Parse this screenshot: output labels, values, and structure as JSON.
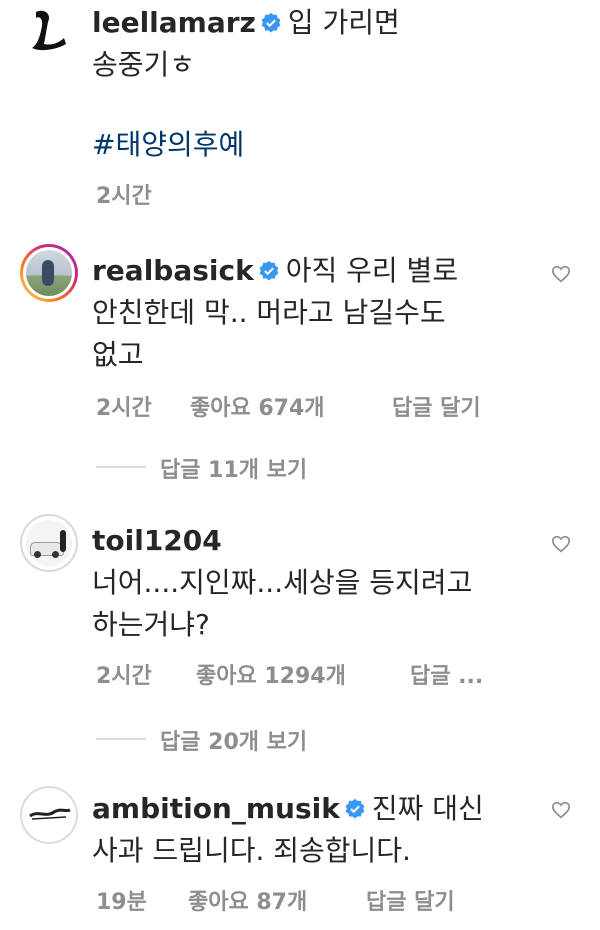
{
  "caption": {
    "username": "leellamarz",
    "text_line1": "입 가리면",
    "text_line2": "송중기ㅎ",
    "hashtag": "#태양의후예",
    "time": "2시간"
  },
  "comments": [
    {
      "username": "realbasick",
      "text_line1": "아직 우리 별로",
      "text_line2": "안친한데 막.. 머라고 남길수도",
      "text_line3": "없고",
      "time": "2시간",
      "likes": "좋아요 674개",
      "reply_label": "답글 달기",
      "view_replies": "답글 11개 보기"
    },
    {
      "username": "toil1204",
      "text_line1": "너어....지인짜...세상을 등지려고",
      "text_line2": "하는거냐?",
      "time": "2시간",
      "likes": "좋아요 1294개",
      "reply_label": "답글 ...",
      "view_replies": "답글 20개 보기"
    },
    {
      "username": "ambition_musik",
      "text_line1": "진짜 대신",
      "text_line2": "사과 드립니다. 죄송합니다.",
      "time": "19분",
      "likes": "좋아요 87개",
      "reply_label": "답글 달기"
    }
  ],
  "colors": {
    "text": "#262626",
    "meta": "#8e8e8e",
    "verified": "#3897f0",
    "hashtag": "#00376b",
    "story_ring": "#d6249f"
  },
  "icons": [
    "verified-badge-icon",
    "heart-icon"
  ]
}
